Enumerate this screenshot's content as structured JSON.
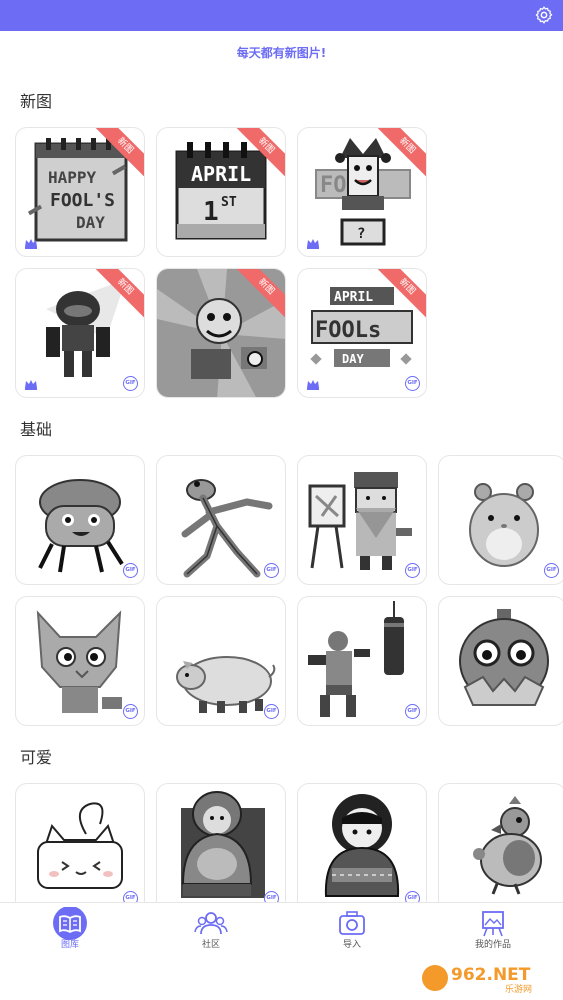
{
  "header": {
    "settings_icon": "gear-icon",
    "bar_color": "#6c6cf5"
  },
  "banner": {
    "text": "每天都有新图片!"
  },
  "sections": [
    {
      "title": "新图"
    },
    {
      "title": "基础"
    },
    {
      "title": "可爱"
    }
  ],
  "badges": {
    "new": "新图",
    "gif": "GIF"
  },
  "tiles": {
    "new": [
      {
        "art": "happy-fools-day-calendar",
        "new": true,
        "premium": true,
        "gif": false
      },
      {
        "art": "april-1st-calendar",
        "new": true,
        "premium": false,
        "gif": false
      },
      {
        "art": "fool-jester-in-box",
        "new": true,
        "premium": true,
        "gif": false
      },
      {
        "art": "robot-mech",
        "new": true,
        "premium": true,
        "gif": true
      },
      {
        "art": "cartoon-rat-chaos",
        "new": true,
        "premium": false,
        "gif": false
      },
      {
        "art": "april-fools-day-lettering",
        "new": true,
        "premium": true,
        "gif": true
      }
    ],
    "basic": [
      {
        "art": "mushroom-creature",
        "gif": true
      },
      {
        "art": "dancing-frog",
        "gif": true
      },
      {
        "art": "bearded-painter",
        "gif": true
      },
      {
        "art": "hamster",
        "gif": true
      },
      {
        "art": "cat-face",
        "gif": true
      },
      {
        "art": "pig",
        "gif": true
      },
      {
        "art": "boxer-punching-bag",
        "gif": true
      },
      {
        "art": "owl-bird",
        "gif": false
      }
    ],
    "cute": [
      {
        "art": "white-cat",
        "gif": true
      },
      {
        "art": "matryoshka-doll-1",
        "gif": true
      },
      {
        "art": "matryoshka-doll-2",
        "gif": true
      },
      {
        "art": "parrot",
        "gif": false
      }
    ]
  },
  "tabs": [
    {
      "label": "图库",
      "icon": "book-icon",
      "active": true
    },
    {
      "label": "社区",
      "icon": "people-icon",
      "active": false
    },
    {
      "label": "导入",
      "icon": "camera-icon",
      "active": false
    },
    {
      "label": "我的作品",
      "icon": "easel-icon",
      "active": false
    }
  ],
  "watermark": {
    "text": "962.NET",
    "subtext": "乐游网"
  }
}
